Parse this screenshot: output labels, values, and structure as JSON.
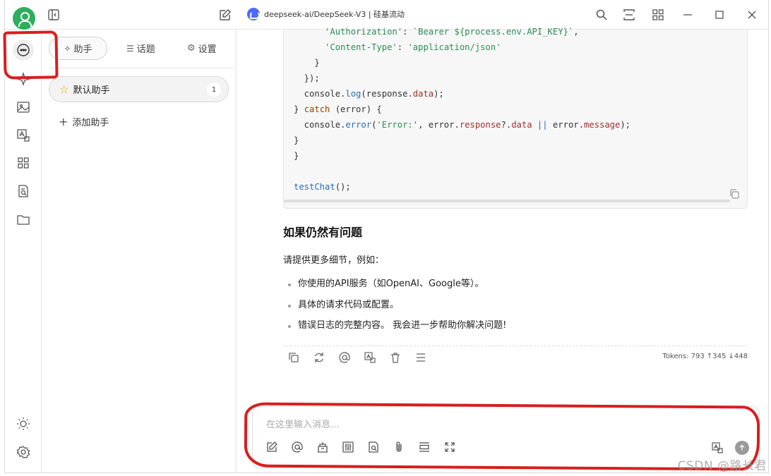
{
  "window": {
    "title": "deepseek-ai/DeepSeek-V3 | 硅基流动",
    "avatar": "user-avatar-icon",
    "controls": [
      "search-icon",
      "fit-width-icon",
      "grid-icon",
      "minimize-icon",
      "maximize-icon",
      "close-icon"
    ]
  },
  "rail": {
    "items": [
      "chat-bubble-icon",
      "sparkle-icon",
      "image-icon",
      "translate-icon",
      "apps-icon",
      "file-search-icon",
      "folder-icon"
    ],
    "bottom": [
      "sun-icon",
      "settings-gear-icon"
    ]
  },
  "panel": {
    "tabs": [
      {
        "label": "助手",
        "icon": "sparkle-icon"
      },
      {
        "label": "话题",
        "icon": "list-icon"
      },
      {
        "label": "设置",
        "icon": "gear-icon"
      }
    ],
    "assistant": {
      "name": "默认助手",
      "icon": "star-icon",
      "count": "1"
    },
    "add_label": "添加助手"
  },
  "code": {
    "lines": [
      "      'Authorization': `Bearer ${process.env.API_KEY}`,",
      "      'Content-Type': 'application/json'",
      "    }",
      "  });",
      "  console.log(response.data);",
      "} catch (error) {",
      "  console.error('Error:', error.response?.data || error.message);",
      "}",
      "}",
      "",
      "testChat();"
    ]
  },
  "message": {
    "heading": "如果仍然有问题",
    "intro": "请提供更多细节，例如：",
    "bullets": [
      "你使用的API服务（如OpenAI、Google等）。",
      "具体的请求代码或配置。",
      "错误日志的完整内容。 我会进一步帮助你解决问题!"
    ],
    "tokens": "Tokens: 793 ↑345 ↓448",
    "actions": [
      "copy-icon",
      "regenerate-icon",
      "mention-icon",
      "translate-icon",
      "delete-icon",
      "menu-icon"
    ]
  },
  "input": {
    "placeholder": "在这里输入消息...",
    "tools": [
      "new-topic-icon",
      "mention-icon",
      "knowledge-base-icon",
      "params-icon",
      "web-search-icon",
      "attachment-icon",
      "clear-icon",
      "expand-icon"
    ],
    "right": [
      "translate-icon",
      "send-icon"
    ]
  },
  "watermark": "CSDN @路长君",
  "annotation_color": "#d81e1e"
}
